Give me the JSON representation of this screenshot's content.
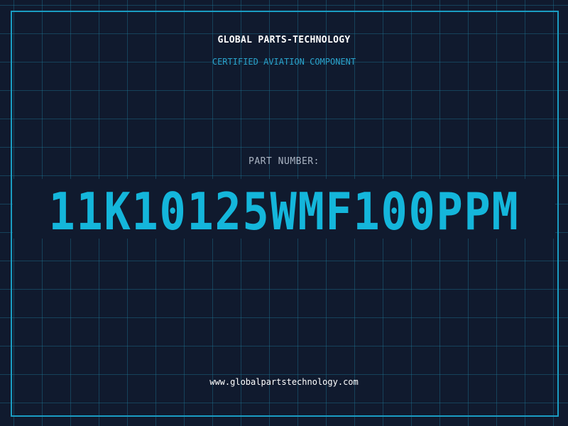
{
  "header": {
    "brand": "GLOBAL PARTS-TECHNOLOGY",
    "subtitle": "CERTIFIED AVIATION COMPONENT"
  },
  "part": {
    "label": "PART NUMBER:",
    "number": "11K10125WMF100PPM"
  },
  "footer": {
    "website": "www.globalpartstechnology.com"
  },
  "colors": {
    "background": "#101a2e",
    "grid": "#1e7896",
    "frame": "#1a9cc2",
    "accent": "#14b6db",
    "brand_text": "#ffffff",
    "label_text": "#a9b3c2"
  }
}
